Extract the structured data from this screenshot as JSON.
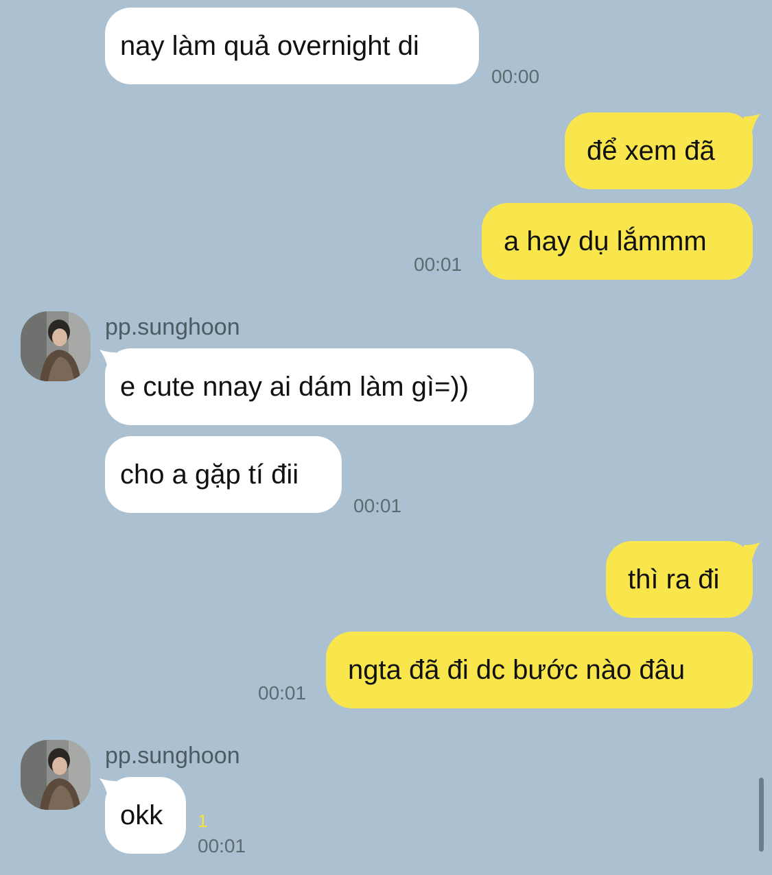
{
  "conversation": {
    "messages": [
      {
        "text": "nay làm quả overnight di"
      },
      {
        "text": "để xem đã"
      },
      {
        "text": "a hay dụ lắmmm"
      },
      {
        "text": "e cute nnay ai dám làm gì=))"
      },
      {
        "text": "cho a gặp tí đii"
      },
      {
        "text": "thì ra đi"
      },
      {
        "text": "ngta đã đi dc bước nào đâu"
      },
      {
        "text": "okk"
      }
    ],
    "times": [
      "00:00",
      "00:01",
      "00:01",
      "00:01",
      "00:01"
    ],
    "senders": [
      "pp.sunghoon",
      "pp.sunghoon"
    ],
    "unread_count": "1"
  },
  "colors": {
    "background": "#abc1d1",
    "incoming_bubble": "#ffffff",
    "outgoing_bubble": "#f9e64d",
    "unread": "#f7e33c"
  },
  "icons": {
    "avatar": "contact-photo"
  }
}
